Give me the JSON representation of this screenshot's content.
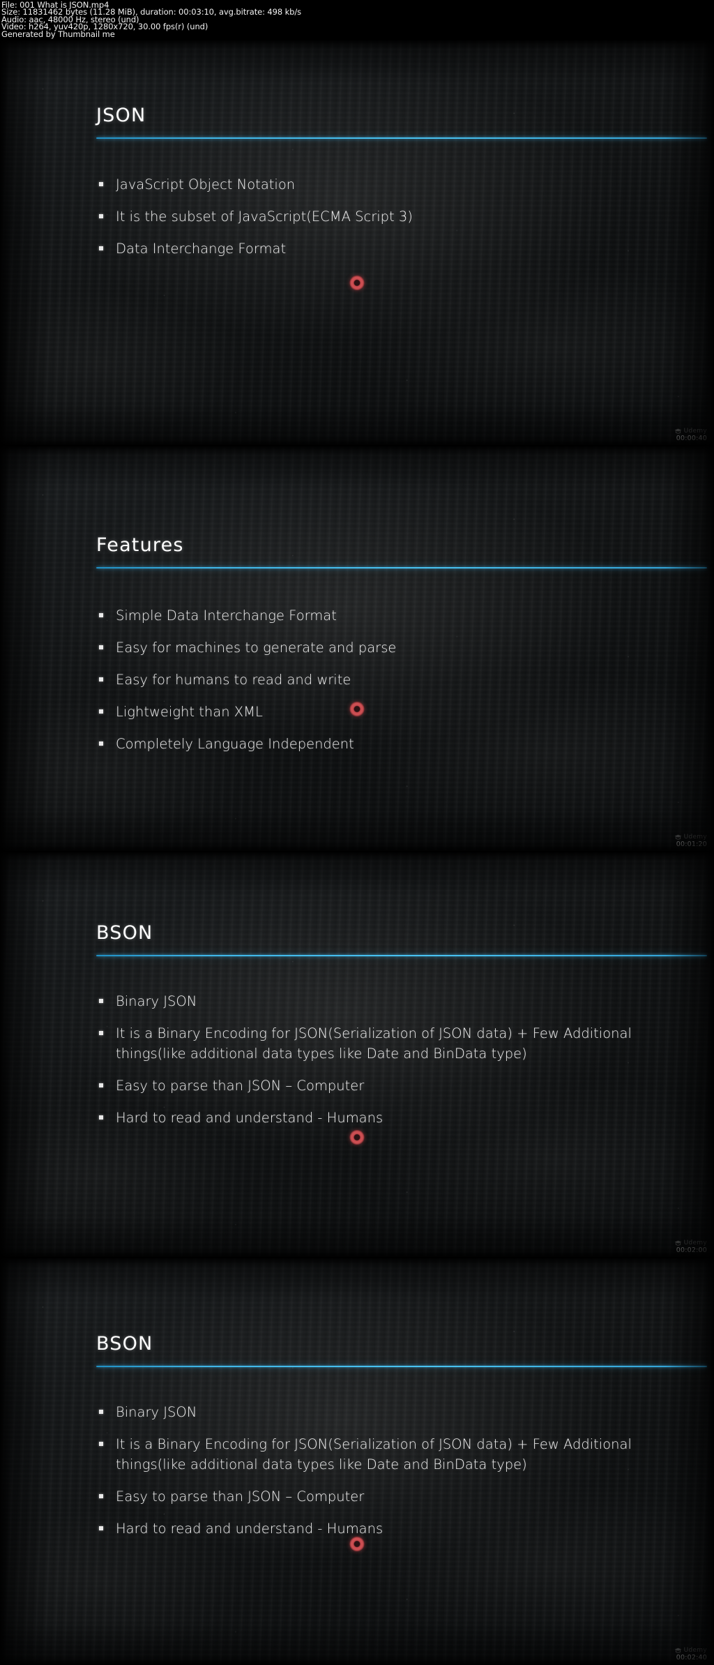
{
  "header": {
    "lines": [
      "File: 001 What is JSON.mp4",
      "Size: 11831462 bytes (11.28 MiB), duration: 00:03:10, avg.bitrate: 498 kb/s",
      "Audio: aac, 48000 Hz, stereo (und)",
      "Video: h264, yuv420p, 1280x720, 30.00 fps(r) (und)",
      "Generated by Thumbnail me"
    ]
  },
  "colors": {
    "accent_rule": "#49c3f2",
    "board_background": "#16181a",
    "text": "#efefef",
    "record_dot": "#d9565a"
  },
  "slides": [
    {
      "title": "JSON",
      "timestamp": "00:00:40",
      "watermark": "Udemy",
      "bullets": [
        "JavaScript Object Notation",
        "It is the subset of JavaScript(ECMA Script 3)",
        "Data Interchange Format"
      ]
    },
    {
      "title": "Features",
      "timestamp": "00:01:20",
      "watermark": "Udemy",
      "bullets": [
        "Simple Data Interchange Format",
        "Easy for machines to generate and parse",
        "Easy for humans to read and write",
        "Lightweight than XML",
        "Completely Language Independent"
      ]
    },
    {
      "title": "BSON",
      "timestamp": "00:02:00",
      "watermark": "Udemy",
      "bullets": [
        "Binary JSON",
        "It is a Binary Encoding for JSON(Serialization of JSON data) + Few Additional things(like additional data types like Date and BinData type)",
        "Easy to parse than JSON – Computer",
        "Hard to read and understand - Humans"
      ]
    },
    {
      "title": "BSON",
      "timestamp": "00:02:40",
      "watermark": "Udemy",
      "bullets": [
        "Binary JSON",
        "It is a Binary Encoding for JSON(Serialization of JSON data) + Few Additional things(like additional data types like Date and BinData type)",
        "Easy to parse than JSON – Computer",
        "Hard to read and understand - Humans"
      ]
    }
  ]
}
